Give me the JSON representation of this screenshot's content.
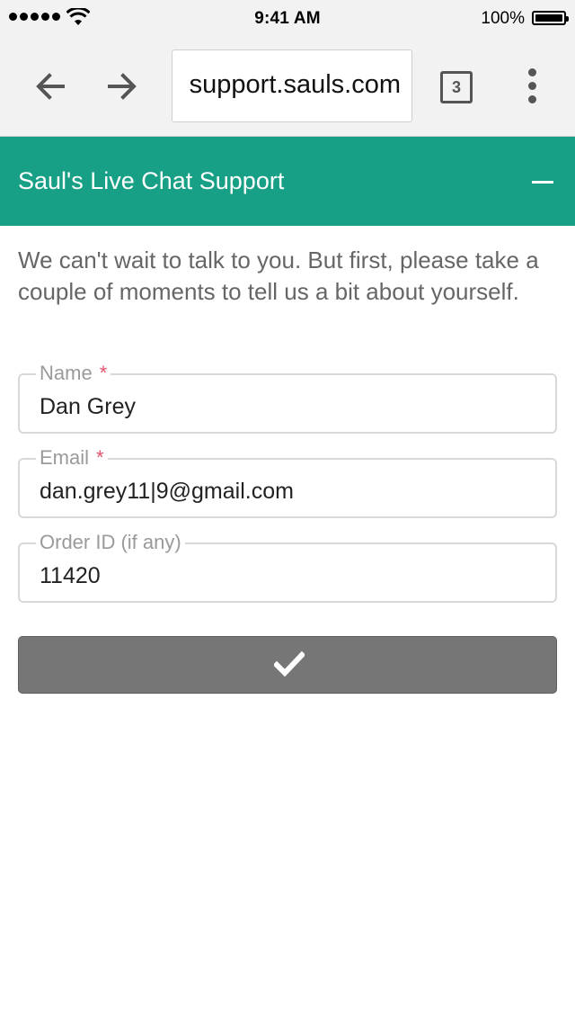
{
  "status_bar": {
    "time": "9:41 AM",
    "battery": "100%"
  },
  "browser": {
    "url": "support.sauls.com",
    "tab_count": "3",
    "icons": [
      "back-arrow-icon",
      "forward-arrow-icon",
      "tabs-icon",
      "overflow-menu-icon"
    ]
  },
  "chat": {
    "title": "Saul's Live Chat Support",
    "intro": "We can't wait to talk to you. But first, please take a couple of moments to tell us a bit about yourself."
  },
  "form": {
    "name": {
      "label": "Name",
      "required_mark": "*",
      "value": "Dan Grey"
    },
    "email": {
      "label": "Email",
      "required_mark": "*",
      "value": "dan.grey11|9@gmail.com"
    },
    "order": {
      "label": "Order ID (if any)",
      "value": "11420"
    }
  },
  "colors": {
    "header_bg": "#17a085",
    "button_bg": "#767676",
    "required": "#e0526b"
  }
}
